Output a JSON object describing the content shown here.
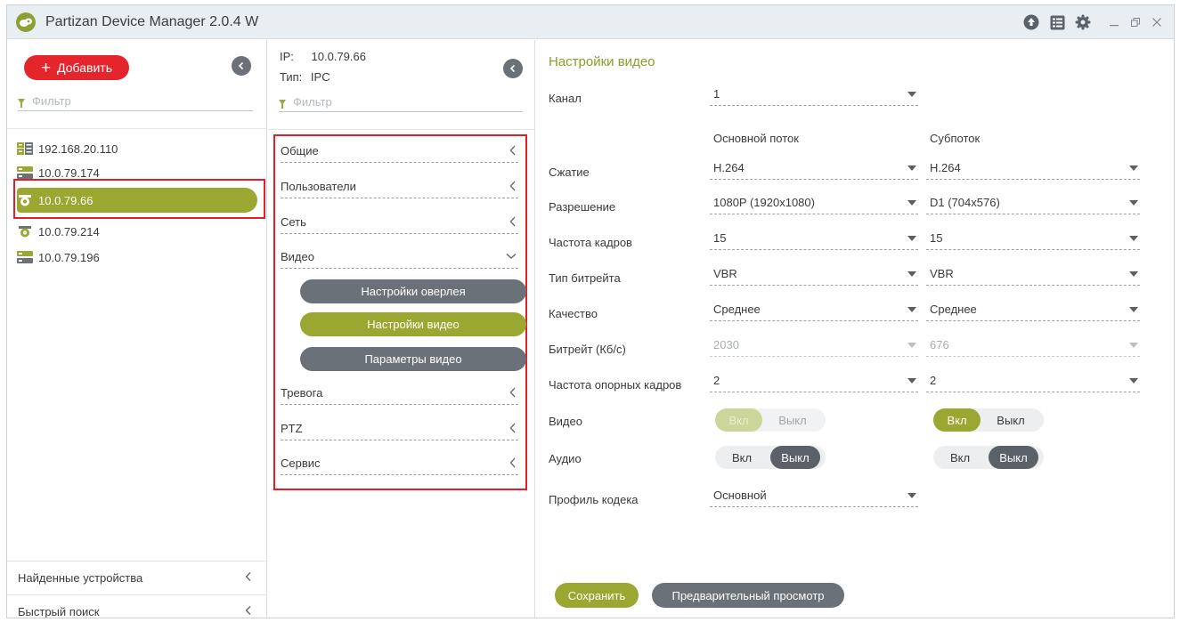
{
  "window": {
    "title": "Partizan Device Manager 2.0.4 W"
  },
  "left": {
    "add_label": "Добавить",
    "filter_placeholder": "Фильтр",
    "devices": [
      {
        "label": "192.168.20.110",
        "icon": "dvr-icon"
      },
      {
        "label": "10.0.79.174",
        "icon": "nvr-icon"
      },
      {
        "label": "10.0.79.66",
        "icon": "ip-camera-icon",
        "selected": true
      },
      {
        "label": "10.0.79.214",
        "icon": "ip-camera-icon"
      },
      {
        "label": "10.0.79.196",
        "icon": "nvr-icon"
      }
    ],
    "found_devices": "Найденные устройства",
    "quick_search": "Быстрый поиск"
  },
  "mid": {
    "ip_label": "IP:",
    "ip_value": "10.0.79.66",
    "type_label": "Тип:",
    "type_value": "IPC",
    "filter_placeholder": "Фильтр",
    "menu": {
      "general": "Общие",
      "users": "Пользователи",
      "network": "Сеть",
      "video": "Видео",
      "overlay_settings": "Настройки оверлея",
      "video_settings": "Настройки видео",
      "video_params": "Параметры видео",
      "alarm": "Тревога",
      "ptz": "PTZ",
      "service": "Сервис"
    }
  },
  "right": {
    "title": "Настройки видео",
    "channel_label": "Канал",
    "channel_value": "1",
    "main_stream": "Основной поток",
    "sub_stream": "Субпоток",
    "rows": {
      "compression": {
        "label": "Сжатие",
        "main": "H.264",
        "sub": "H.264"
      },
      "resolution": {
        "label": "Разрешение",
        "main": "1080P (1920x1080)",
        "sub": "D1 (704x576)"
      },
      "framerate": {
        "label": "Частота кадров",
        "main": "15",
        "sub": "15"
      },
      "bitrate_type": {
        "label": "Тип битрейта",
        "main": "VBR",
        "sub": "VBR"
      },
      "quality": {
        "label": "Качество",
        "main": "Среднее",
        "sub": "Среднее"
      },
      "bitrate": {
        "label": "Битрейт (Кб/с)",
        "main": "2030",
        "sub": "676"
      },
      "keyframe": {
        "label": "Частота опорных кадров",
        "main": "2",
        "sub": "2"
      }
    },
    "video_label": "Видео",
    "audio_label": "Аудио",
    "on": "Вкл",
    "off": "Выкл",
    "codec_profile_label": "Профиль кодека",
    "codec_profile_value": "Основной",
    "save_label": "Сохранить",
    "preview_label": "Предварительный просмотр"
  },
  "colors": {
    "accent": "#9aa832",
    "add": "#e4252c",
    "gray": "#6b7178",
    "highlight": "#e31e24"
  }
}
